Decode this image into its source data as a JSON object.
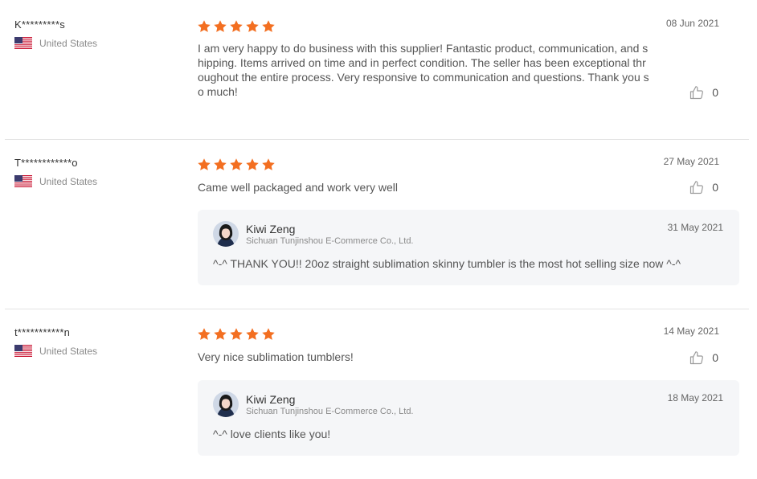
{
  "colors": {
    "star": "#f36f21",
    "reply_bg": "#f5f6f8",
    "divider": "#e3e3e3"
  },
  "reviews": [
    {
      "buyer": "K*********s",
      "country": "United States",
      "flag_icon": "us-flag-icon",
      "rating": 5,
      "date": "08 Jun 2021",
      "text": "I am very happy to do business with this supplier! Fantastic product, communication, and shipping. Items arrived on time and in perfect condition. The seller has been exceptional throughout the entire process. Very responsive to communication and questions. Thank you so much!",
      "likes": "0"
    },
    {
      "buyer": "T************o",
      "country": "United States",
      "flag_icon": "us-flag-icon",
      "rating": 5,
      "date": "27 May 2021",
      "text": "Came well packaged and work very well",
      "likes": "0",
      "reply": {
        "seller": "Kiwi Zeng",
        "company": "Sichuan Tunjinshou E-Commerce Co., Ltd.",
        "date": "31 May 2021",
        "text": "^-^  THANK YOU!! 20oz straight sublimation skinny tumbler is the most hot selling size now ^-^"
      }
    },
    {
      "buyer": "t***********n",
      "country": "United States",
      "flag_icon": "us-flag-icon",
      "rating": 5,
      "date": "14 May 2021",
      "text": "Very nice sublimation tumblers!",
      "likes": "0",
      "reply": {
        "seller": "Kiwi Zeng",
        "company": "Sichuan Tunjinshou E-Commerce Co., Ltd.",
        "date": "18 May 2021",
        "text": "^-^ love clients like you!"
      }
    }
  ]
}
